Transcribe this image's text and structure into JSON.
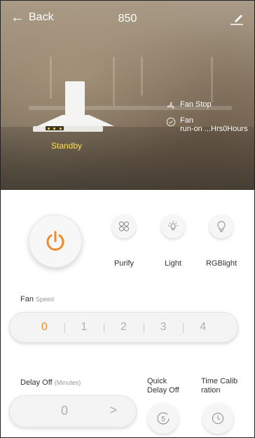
{
  "topbar": {
    "back_label": "Back",
    "title": "850"
  },
  "device": {
    "status": "Standby"
  },
  "status_list": [
    {
      "icon": "fan-icon",
      "text": "Fan Stop"
    },
    {
      "icon": "check-circle-icon",
      "line1": "Fan",
      "line2": "run-on ...Hrs0Hours"
    }
  ],
  "functions": {
    "purify": "Purify",
    "light": "Light",
    "rgblight": "RGBlight"
  },
  "fan": {
    "label": "Fan",
    "sublabel": "Speed",
    "speeds": [
      "0",
      "1",
      "2",
      "3",
      "4"
    ],
    "selected": "0"
  },
  "delay": {
    "label": "Delay Off",
    "sublabel": "(Minutes)",
    "value": "0",
    "arrow": ">"
  },
  "quick_delay": {
    "line1": "Quick",
    "line2": "Delay Off",
    "badge": "5"
  },
  "time_calib": {
    "line1": "Time Calib",
    "line2": "ration"
  },
  "colors": {
    "accent": "#ef8b2c",
    "standby": "#ffe14a"
  }
}
